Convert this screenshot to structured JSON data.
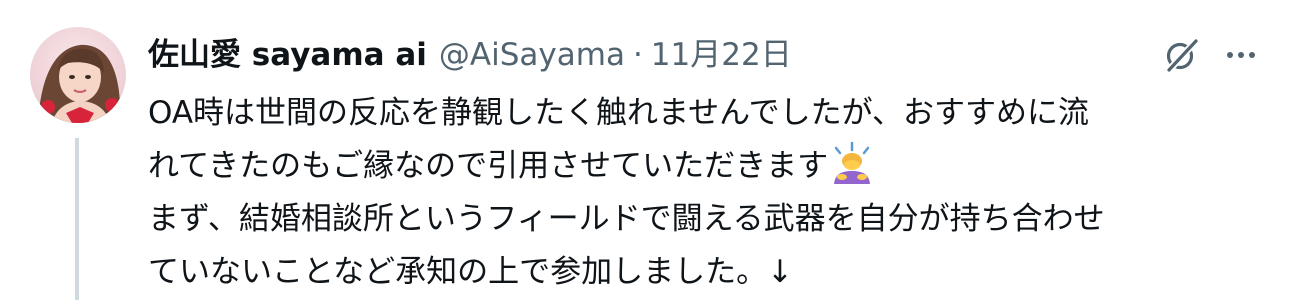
{
  "author": {
    "display_name": "佐山愛 sayama ai",
    "handle": "@AiSayama",
    "separator": "·",
    "timestamp": "11月22日"
  },
  "icons": {
    "avatar": "avatar-photo",
    "left_action": "grok-icon",
    "right_action": "more-icon",
    "inline_emoji": "person-bowing-emoji"
  },
  "tweet": {
    "lines": [
      "OA時は世間の反応を静観したく触れませんでしたが、おすすめに流",
      "れてきたのもご縁なので引用させていただきます",
      "まず、結婚相談所というフィールドで闘える武器を自分が持ち合わせ",
      "ていないことなど承知の上で参加しました。↓"
    ]
  },
  "colors": {
    "text_primary": "#0f1419",
    "text_secondary": "#536471",
    "thread_line": "#cfd9de"
  }
}
